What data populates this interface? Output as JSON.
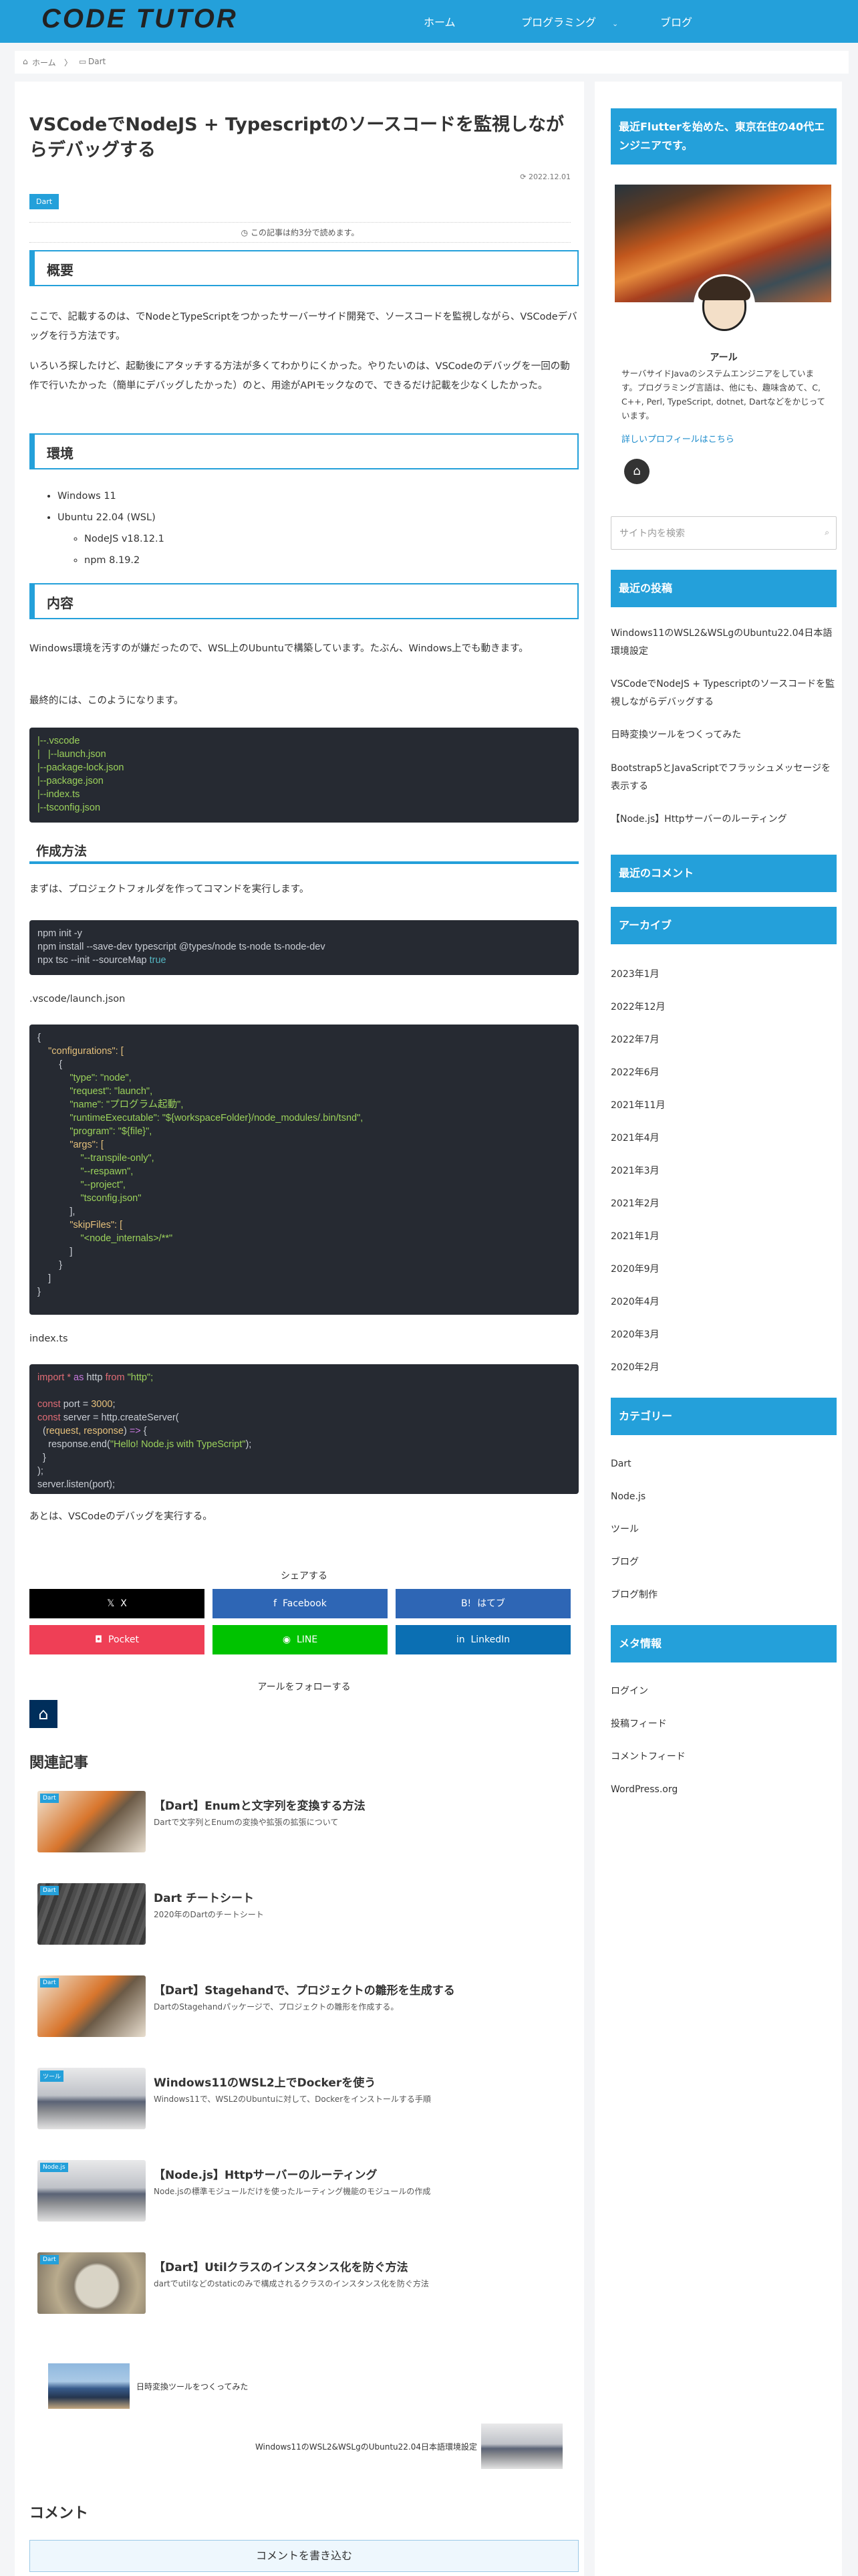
{
  "header": {
    "logo": "CODE TUTOR",
    "nav": [
      {
        "label": "ホーム"
      },
      {
        "label": "プログラミング"
      },
      {
        "label": "ブログ"
      }
    ],
    "dropdown_mark": "⌄"
  },
  "breadcrumb": {
    "home": "ホーム",
    "sep": "〉",
    "current": "Dart"
  },
  "article": {
    "title": "VSCodeでNodeJS + Typescriptのソースコードを監視しながらデバッグする",
    "date": "2022.12.01",
    "date_icon": "⟳",
    "category": "Dart",
    "read_time": "この記事は約3分で読めます。",
    "read_icon": "◷",
    "h_overview": "概要",
    "p1": "ここで、記載するのは、でNodeとTypeScriptをつかったサーバーサイド開発で、ソースコードを監視しながら、VSCodeデバッグを行う方法です。",
    "p2": "いろいろ探したけど、起動後にアタッチする方法が多くてわかりにくかった。やりたいのは、VSCodeのデバッグを一回の動作で行いたかった（簡単にデバッグしたかった）のと、用途がAPIモックなので、できるだけ記載を少なくしたかった。",
    "h_env": "環境",
    "env_items": [
      "Windows 11",
      "Ubuntu 22.04 (WSL)"
    ],
    "env_sub": [
      "NodeJS v18.12.1",
      "npm 8.19.2"
    ],
    "h_content": "内容",
    "p3": "Windows環境を汚すのが嫌だったので、WSL上のUbuntuで構築しています。たぶん、Windows上でも動きます。",
    "p4": "最終的には、このようになります。",
    "tree": [
      "|--.vscode",
      "|   |--launch.json",
      "|--package-lock.json",
      "|--package.json",
      "|--index.ts",
      "|--tsconfig.json"
    ],
    "h_make": "作成方法",
    "p5": "まずは、プロジェクトフォルダを作ってコマンドを実行します。",
    "cmd": [
      "npm init -y",
      "npm install --save-dev typescript @types/node ts-node ts-node-dev",
      "npx tsc --init --sourceMap "
    ],
    "cmd_true": "true",
    "file1": ".vscode/launch.json",
    "launch": [
      "{",
      "    \"configurations\": [",
      "        {",
      "            \"type\": \"node\",",
      "            \"request\": \"launch\",",
      "            \"name\": \"プログラム起動\",",
      "            \"runtimeExecutable\": \"${workspaceFolder}/node_modules/.bin/tsnd\",",
      "            \"program\": \"${file}\",",
      "            \"args\": [",
      "                \"--transpile-only\",",
      "                \"--respawn\",",
      "                \"--project\",",
      "                \"tsconfig.json\"",
      "            ],",
      "            \"skipFiles\": [",
      "                \"<node_internals>/**\"",
      "            ]",
      "        }",
      "    ]",
      "}"
    ],
    "file2": "index.ts",
    "index_code": {
      "l1a": "import",
      "l1b": " * ",
      "l1c": "as",
      "l1d": " http ",
      "l1e": "from",
      "l1f": " \"http\";",
      "l3a": "const",
      "l3b": " port = ",
      "l3c": "3000",
      "l3d": ";",
      "l4a": "const",
      "l4b": " server = http.createServer(",
      "l5a": "  (",
      "l5b": "request, response",
      "l5c": ") ",
      "l5d": "=>",
      "l5e": " {",
      "l6a": "    response.end(",
      "l6b": "\"Hello! Node.js with TypeScript\"",
      "l6c": ");",
      "l7": "  }",
      "l8": ");",
      "l9": "server.listen(port);"
    },
    "p6": "あとは、VSCodeのデバッグを実行する。"
  },
  "share": {
    "label": "シェアする",
    "buttons": [
      {
        "label": "X",
        "icon": "𝕏",
        "color": "#000000"
      },
      {
        "label": "Facebook",
        "icon": "f",
        "color": "#2e66b5"
      },
      {
        "label": "はてブ",
        "icon": "B!",
        "color": "#2e66b5"
      },
      {
        "label": "Pocket",
        "icon": "◘",
        "color": "#ef3f56"
      },
      {
        "label": "LINE",
        "icon": "◉",
        "color": "#00c300"
      },
      {
        "label": "LinkedIn",
        "icon": "in",
        "color": "#0b6fb3"
      }
    ]
  },
  "follow": {
    "label": "アールをフォローする"
  },
  "related": {
    "heading": "関連記事",
    "items": [
      {
        "title": "【Dart】Enumと文字列を変換する方法",
        "summary": "Dartで文字列とEnumの変換や拡張の拡張について",
        "tag": "Dart"
      },
      {
        "title": "Dart チートシート",
        "summary": "2020年のDartのチートシート",
        "tag": "Dart"
      },
      {
        "title": "【Dart】Stagehandで、プロジェクトの雛形を生成する",
        "summary": "DartのStagehandパッケージで、プロジェクトの雛形を作成する。",
        "tag": "Dart"
      },
      {
        "title": "Windows11のWSL2上でDockerを使う",
        "summary": "Windows11で、WSL2のUbuntuに対して、Dockerをインストールする手順",
        "tag": "ツール"
      },
      {
        "title": "【Node.js】Httpサーバーのルーティング",
        "summary": "Node.jsの標準モジュールだけを使ったルーティング機能のモジュールの作成",
        "tag": "Node.js"
      },
      {
        "title": "【Dart】Utilクラスのインスタンス化を防ぐ方法",
        "summary": "dartでutilなどのstaticのみで構成されるクラスのインスタンス化を防ぐ方法",
        "tag": "Dart"
      }
    ]
  },
  "pager": {
    "prev": "日時変換ツールをつくってみた",
    "next": "Windows11のWSL2&WSLgのUbuntu22.04日本語環境設定"
  },
  "comments": {
    "heading": "コメント",
    "write": "コメントを書き込む"
  },
  "sidebar": {
    "profile_head": "最近Flutterを始めた、東京在住の40代エンジニアです。",
    "name": "アール",
    "desc": "サーバサイドJavaのシステムエンジニアをしています。プログラミング言語は、他にも、趣味含めて、C, C++, Perl, TypeScript, dotnet, Dartなどをかじっています。",
    "profile_link": "詳しいプロフィールはこちら",
    "home_icon": "⌂",
    "search_placeholder": "サイト内を検索",
    "search_icon": "⌕",
    "recent_head": "最近の投稿",
    "recent": [
      "Windows11のWSL2&WSLgのUbuntu22.04日本語環境設定",
      "VSCodeでNodeJS + Typescriptのソースコードを監視しながらデバッグする",
      "日時変換ツールをつくってみた",
      "Bootstrap5とJavaScriptでフラッシュメッセージを表示する",
      "【Node.js】Httpサーバーのルーティング"
    ],
    "comments_head": "最近のコメント",
    "archive_head": "アーカイブ",
    "archives": [
      "2023年1月",
      "2022年12月",
      "2022年7月",
      "2022年6月",
      "2021年11月",
      "2021年4月",
      "2021年3月",
      "2021年2月",
      "2021年1月",
      "2020年9月",
      "2020年4月",
      "2020年3月",
      "2020年2月"
    ],
    "category_head": "カテゴリー",
    "categories": [
      "Dart",
      "Node.js",
      "ツール",
      "ブログ",
      "ブログ制作"
    ],
    "meta_head": "メタ情報",
    "meta": [
      "ログイン",
      "投稿フィード",
      "コメントフィード",
      "WordPress.org"
    ]
  },
  "colors": {
    "accent": "#24a0da",
    "dark_code": "#262a32"
  }
}
